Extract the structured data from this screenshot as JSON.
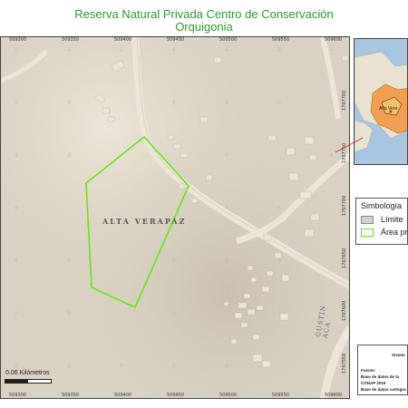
{
  "title": {
    "line1": "Reserva Natural Privada Centro de Conservación",
    "line2": "Orquigonia"
  },
  "map": {
    "region_label": "ALTA VERAPAZ",
    "road_label": "GUSTÍN ACA",
    "x_ticks_top": [
      "509300",
      "509350",
      "509400",
      "509450",
      "509500",
      "509550",
      "509600"
    ],
    "x_ticks_bottom": [
      "509300",
      "509350",
      "509400",
      "509450",
      "509500",
      "509550",
      "509600"
    ],
    "y_ticks_right": [
      "1707700",
      "1707750",
      "1707700",
      "1707650",
      "1707600",
      "1707550"
    ],
    "scale_text": "0.06 Kilómetros",
    "colors": {
      "reserve_outline": "#66e61a",
      "background": "#d9d2c2",
      "road": "#ece6d8"
    }
  },
  "inset": {
    "label": "Alta Vera"
  },
  "legend": {
    "title": "Simbología",
    "items": [
      {
        "label": "Límite",
        "color": "#d0d0d0",
        "border": "#888888"
      },
      {
        "label": "Área pr",
        "color": "#ffffff",
        "border": "#66e61a"
      }
    ]
  },
  "info": {
    "header": "Sistem",
    "fuente_label": "Fuente:",
    "line1": "Base de datos de la",
    "line2": "CONAP 2016",
    "line3": "Base de datos cartogra"
  }
}
